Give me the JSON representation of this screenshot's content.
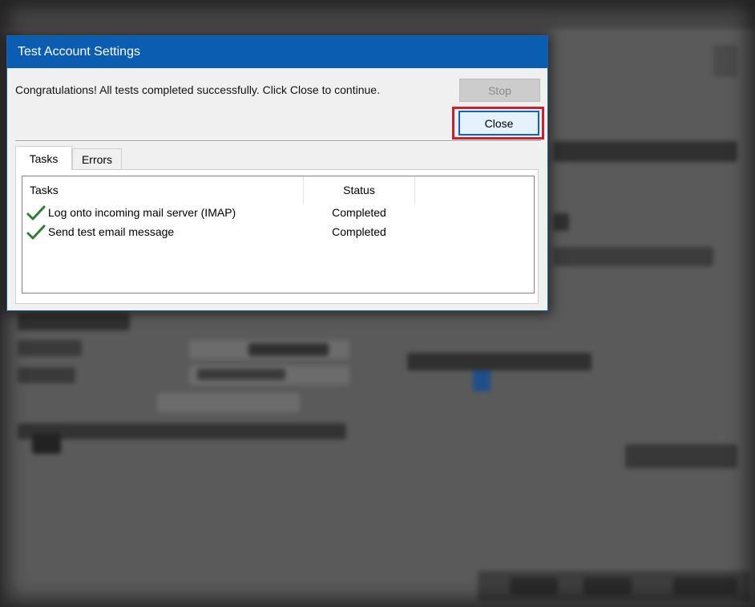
{
  "dialog": {
    "title": "Test Account Settings",
    "message": "Congratulations! All tests completed successfully. Click Close to continue.",
    "stop_label": "Stop",
    "close_label": "Close"
  },
  "tabs": [
    {
      "label": "Tasks",
      "selected": true
    },
    {
      "label": "Errors",
      "selected": false
    }
  ],
  "table": {
    "columns": [
      "Tasks",
      "Status"
    ],
    "rows": [
      {
        "task": "Log onto incoming mail server (IMAP)",
        "status": "Completed",
        "icon": "check-icon"
      },
      {
        "task": "Send test email message",
        "status": "Completed",
        "icon": "check-icon"
      }
    ]
  },
  "colors": {
    "title_bar": "#0b5db1",
    "highlight": "#c8202f",
    "check": "#2e7d32"
  }
}
